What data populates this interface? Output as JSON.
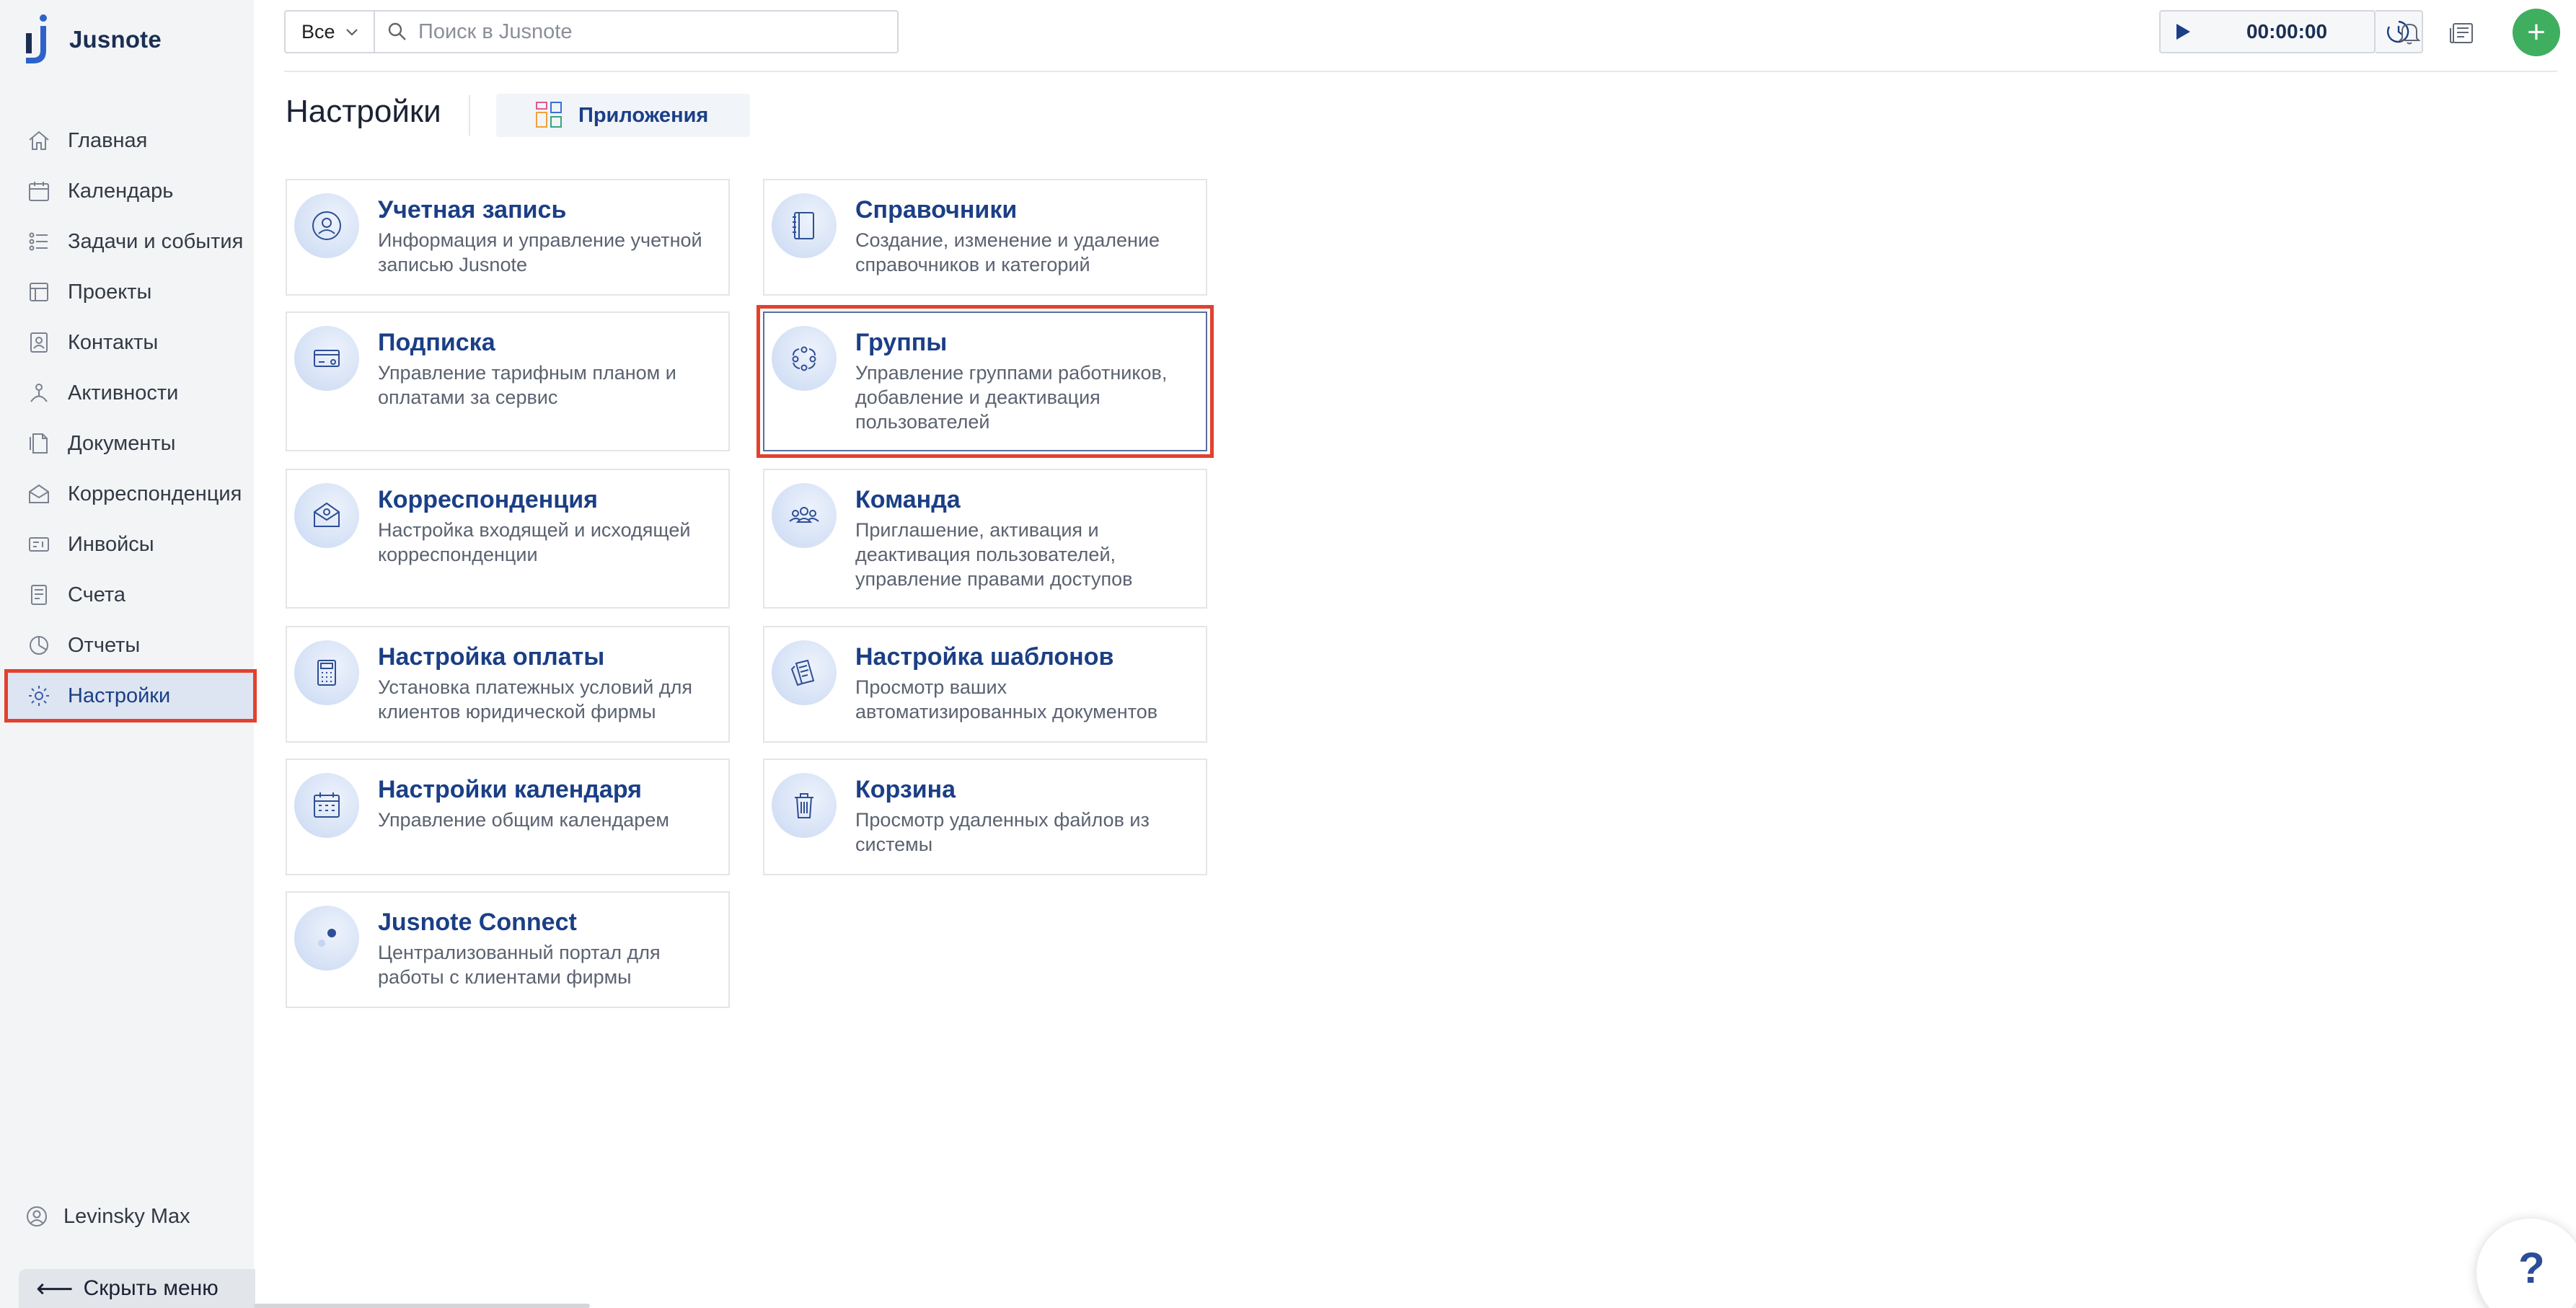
{
  "app": {
    "name": "Jusnote"
  },
  "sidebar": {
    "items": [
      {
        "key": "home",
        "label": "Главная",
        "icon": "home-icon"
      },
      {
        "key": "calendar",
        "label": "Календарь",
        "icon": "calendar-icon"
      },
      {
        "key": "tasks",
        "label": "Задачи и события",
        "icon": "tasks-icon"
      },
      {
        "key": "projects",
        "label": "Проекты",
        "icon": "projects-icon"
      },
      {
        "key": "contacts",
        "label": "Контакты",
        "icon": "contacts-icon"
      },
      {
        "key": "activities",
        "label": "Активности",
        "icon": "activities-icon"
      },
      {
        "key": "documents",
        "label": "Документы",
        "icon": "documents-icon"
      },
      {
        "key": "correspondence",
        "label": "Корреспонденция",
        "icon": "correspondence-icon"
      },
      {
        "key": "invoices",
        "label": "Инвойсы",
        "icon": "invoices-icon"
      },
      {
        "key": "accounts",
        "label": "Счета",
        "icon": "accounts-icon"
      },
      {
        "key": "reports",
        "label": "Отчеты",
        "icon": "reports-icon"
      },
      {
        "key": "settings",
        "label": "Настройки",
        "icon": "gear-icon",
        "active": true
      }
    ],
    "user_name": "Levinsky Max",
    "hide_menu_label": "Скрыть меню"
  },
  "header": {
    "filter_value": "Все",
    "search_placeholder": "Поиск в Jusnote",
    "timer_value": "00:00:00"
  },
  "page": {
    "title": "Настройки",
    "apps_tab_label": "Приложения"
  },
  "cards": {
    "account": {
      "title": "Учетная запись",
      "desc": "Информация и управление учетной записью Jusnote",
      "icon": "account-icon"
    },
    "references": {
      "title": "Справочники",
      "desc": "Создание, изменение и удаление справочников и категорий",
      "icon": "book-icon"
    },
    "subscription": {
      "title": "Подписка",
      "desc": "Управление тарифным планом и оплатами за сервис",
      "icon": "credit-card-icon"
    },
    "groups": {
      "title": "Группы",
      "desc": "Управление группами работников, добавление и деактивация пользователей",
      "icon": "groups-icon"
    },
    "correspondence": {
      "title": "Корреспонденция",
      "desc": "Настройка входящей и исходящей корреспонденции",
      "icon": "envelope-icon"
    },
    "team": {
      "title": "Команда",
      "desc": "Приглашение, активация и деактивация пользователей, управление правами доступов",
      "icon": "team-icon"
    },
    "payment": {
      "title": "Настройка оплаты",
      "desc": "Установка платежных условий для клиентов юридической фирмы",
      "icon": "calculator-icon"
    },
    "templates": {
      "title": "Настройка шаблонов",
      "desc": "Просмотр ваших автоматизированных документов",
      "icon": "templates-icon"
    },
    "calendar": {
      "title": "Настройки календаря",
      "desc": "Управление общим календарем",
      "icon": "calendar-icon"
    },
    "trash": {
      "title": "Корзина",
      "desc": "Просмотр удаленных файлов из системы",
      "icon": "trash-icon"
    },
    "connect": {
      "title": "Jusnote Connect",
      "desc": "Централизованный портал для работы с клиентами фирмы",
      "icon": "connect-icon"
    }
  },
  "help": {
    "label": "?"
  },
  "colors": {
    "accent": "#1b3f86",
    "highlight": "#e2412e",
    "add_button": "#3fae5f"
  }
}
